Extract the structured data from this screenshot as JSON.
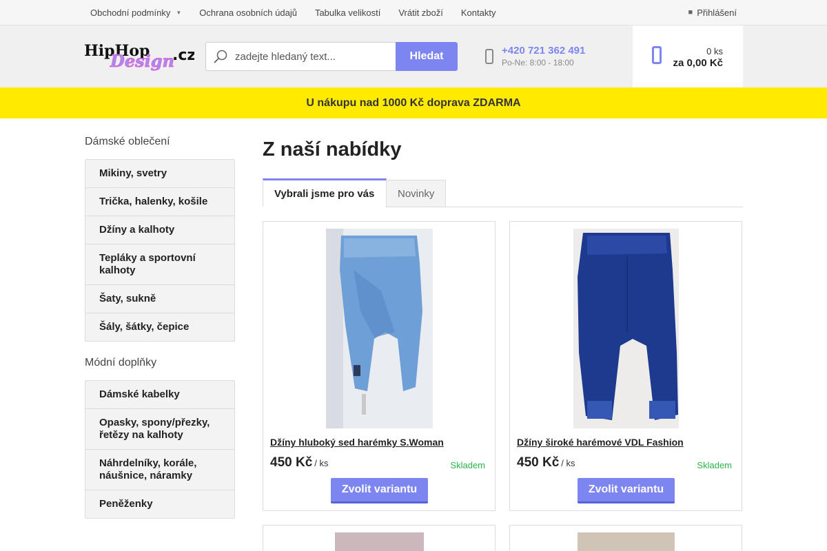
{
  "topbar": {
    "nav": [
      {
        "label": "Obchodní podmínky",
        "has_dropdown": true
      },
      {
        "label": "Ochrana osobních údajů"
      },
      {
        "label": "Tabulka velikostí"
      },
      {
        "label": "Vrátit zboží"
      },
      {
        "label": "Kontakty"
      }
    ],
    "login_label": "Přihlášení"
  },
  "header": {
    "logo_alt": "HipHopDesign.cz",
    "search_placeholder": "zadejte hledaný text...",
    "search_button": "Hledat",
    "phone": "+420 721 362 491",
    "hours": "Po-Ne: 8:00 - 18:00",
    "cart_count": "0 ks",
    "cart_total": "za 0,00 Kč"
  },
  "banner": "U nákupu nad 1000 Kč doprava ZDARMA",
  "sidebar": {
    "sections": [
      {
        "heading": "Dámské oblečení",
        "items": [
          "Mikiny, svetry",
          "Trička, halenky, košile",
          "Džíny a kalhoty",
          "Tepláky a sportovní kalhoty",
          "Šaty, sukně",
          "Šály, šátky, čepice"
        ]
      },
      {
        "heading": "Módní doplňky",
        "items": [
          "Dámské kabelky",
          "Opasky, spony/přezky, řetězy na kalhoty",
          "Náhrdelníky, korále, náušnice, náramky",
          "Peněženky"
        ]
      }
    ]
  },
  "main": {
    "title": "Z naší nabídky",
    "tabs": [
      "Vybrali jsme pro vás",
      "Novinky"
    ],
    "products": [
      {
        "name": "Džíny hluboký sed harémky S.Woman",
        "price": "450 Kč",
        "unit": "/ ks",
        "stock": "Skladem",
        "button": "Zvolit variantu"
      },
      {
        "name": "Džíny široké harémové VDL Fashion",
        "price": "450 Kč",
        "unit": "/ ks",
        "stock": "Skladem",
        "button": "Zvolit variantu"
      }
    ]
  },
  "colors": {
    "accent": "#7d86f0",
    "banner": "#ffea00",
    "stock": "#2cb34a"
  }
}
